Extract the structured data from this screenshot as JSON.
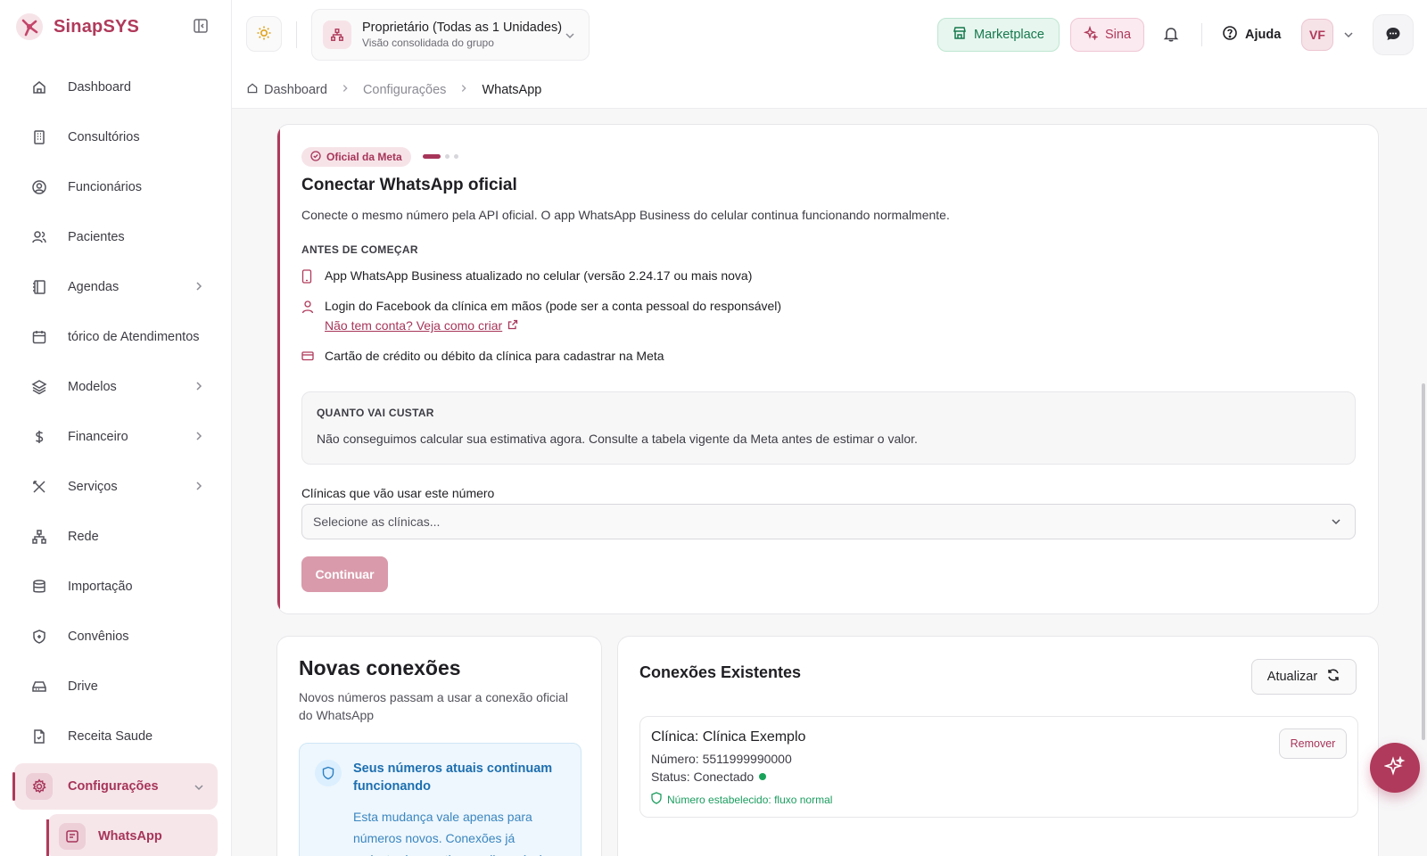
{
  "colors": {
    "accent": "#b03a5b",
    "success": "#19a35a",
    "info": "#1d6fb0"
  },
  "brand": {
    "name": "SinapSYS"
  },
  "sidebar": {
    "items": [
      {
        "label": "Dashboard",
        "icon": "home-icon"
      },
      {
        "label": "Consultórios",
        "icon": "building-icon"
      },
      {
        "label": "Funcionários",
        "icon": "user-circle-icon"
      },
      {
        "label": "Pacientes",
        "icon": "users-icon"
      },
      {
        "label": "Agendas",
        "icon": "book-icon",
        "has_children": true
      },
      {
        "label": "tórico de Atendimentos",
        "icon": "calendar-icon"
      },
      {
        "label": "Modelos",
        "icon": "layers-icon",
        "has_children": true
      },
      {
        "label": "Financeiro",
        "icon": "dollar-icon",
        "has_children": true
      },
      {
        "label": "Serviços",
        "icon": "tools-icon",
        "has_children": true
      },
      {
        "label": "Rede",
        "icon": "network-icon"
      },
      {
        "label": "Importação",
        "icon": "database-icon"
      },
      {
        "label": "Convênios",
        "icon": "shield-icon"
      },
      {
        "label": "Drive",
        "icon": "drive-icon"
      },
      {
        "label": "Receita Saude",
        "icon": "file-icon"
      },
      {
        "label": "Configurações",
        "icon": "gear-icon",
        "active": true,
        "expanded": true
      }
    ],
    "subitem": {
      "label": "WhatsApp",
      "icon": "message-square-icon"
    }
  },
  "header": {
    "org": {
      "title": "Proprietário (Todas as 1 Unidades)",
      "subtitle": "Visão consolidada do grupo"
    },
    "marketplace_label": "Marketplace",
    "sina_label": "Sina",
    "help_label": "Ajuda",
    "avatar_initials": "VF"
  },
  "breadcrumb": {
    "home": "Dashboard",
    "middle": "Configurações",
    "current": "WhatsApp"
  },
  "connect": {
    "badge": "Oficial da Meta",
    "step": 1,
    "steps_total": 3,
    "title": "Conectar WhatsApp oficial",
    "description": "Conecte o mesmo número pela API oficial. O app WhatsApp Business do celular continua funcionando normalmente.",
    "before_label": "ANTES DE COMEÇAR",
    "requirements": [
      "App WhatsApp Business atualizado no celular (versão 2.24.17 ou mais nova)",
      "Login do Facebook da clínica em mãos (pode ser a conta pessoal do responsável)",
      "Cartão de crédito ou débito da clínica para cadastrar na Meta"
    ],
    "account_link": "Não tem conta? Veja como criar",
    "cost_label": "QUANTO VAI CUSTAR",
    "cost_text": "Não conseguimos calcular sua estimativa agora. Consulte a tabela vigente da Meta antes de estimar o valor.",
    "clinics_label": "Clínicas que vão usar este número",
    "clinics_placeholder": "Selecione as clínicas...",
    "continue_label": "Continuar"
  },
  "new_connections": {
    "title": "Novas conexões",
    "description": "Novos números passam a usar a conexão oficial do WhatsApp",
    "info_title": "Seus números atuais continuam funcionando",
    "info_text": "Esta mudança vale apenas para números novos. Conexões já cadastradas continuam disponíveis"
  },
  "existing": {
    "title": "Conexões Existentes",
    "refresh_label": "Atualizar",
    "connection": {
      "clinic": "Clínica: Clínica Exemplo",
      "number": "Número: 5511999990000",
      "status": "Status: Conectado",
      "note": "Número estabelecido: fluxo normal",
      "remove_label": "Remover"
    }
  }
}
